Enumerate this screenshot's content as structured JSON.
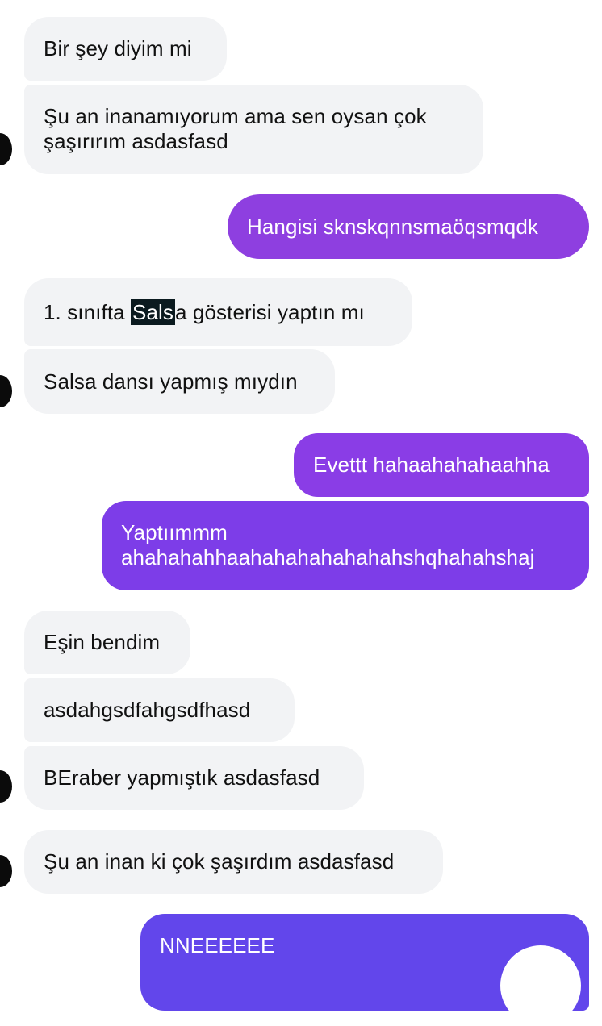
{
  "conversation": {
    "messages": [
      {
        "id": "m1",
        "sender": "contact",
        "text": "Bir şey diyim mi"
      },
      {
        "id": "m2",
        "sender": "contact",
        "lines": [
          "Şu an inanamıyorum ama sen oysan çok",
          "şaşırırım asdasfasd"
        ]
      },
      {
        "id": "m3",
        "sender": "me",
        "text": "Hangisi sknskqnnsmaöqsmqdk"
      },
      {
        "id": "m4",
        "sender": "contact",
        "prefix": "1.  sınıfta ",
        "highlight": "Sals",
        "suffix": "a gösterisi yaptın mı"
      },
      {
        "id": "m5",
        "sender": "contact",
        "text": "Salsa dansı yapmış mıydın"
      },
      {
        "id": "m6",
        "sender": "me",
        "text": "Evettt hahaahahahaahha"
      },
      {
        "id": "m7",
        "sender": "me",
        "lines": [
          "Yaptıımmm",
          "ahahahahhaahahahahahahahshqhahahshaj"
        ]
      },
      {
        "id": "m8",
        "sender": "contact",
        "text": "Eşin bendim"
      },
      {
        "id": "m9",
        "sender": "contact",
        "text": "asdahgsdfahgsdfhasd"
      },
      {
        "id": "m10",
        "sender": "contact",
        "text": "BEraber yapmıştık asdasfasd"
      },
      {
        "id": "m11",
        "sender": "contact",
        "text": "Şu an inan ki çok şaşırdım asdasfasd"
      },
      {
        "id": "m12",
        "sender": "me",
        "text": "NNEEEEEE"
      }
    ]
  },
  "colors": {
    "incoming_bubble": "#f2f3f5",
    "incoming_text": "#111111",
    "outgoing_text": "#ffffff",
    "outgoing_gradient": [
      "#8e3fe0",
      "#8a3de6",
      "#7d3de8",
      "#743eea",
      "#6246eb"
    ],
    "selection_highlight": "#0b1a1f",
    "avatar": "#0b0b0b"
  },
  "icons": {
    "avatar": "contact-avatar",
    "scroll_button": "scroll-down-button"
  }
}
